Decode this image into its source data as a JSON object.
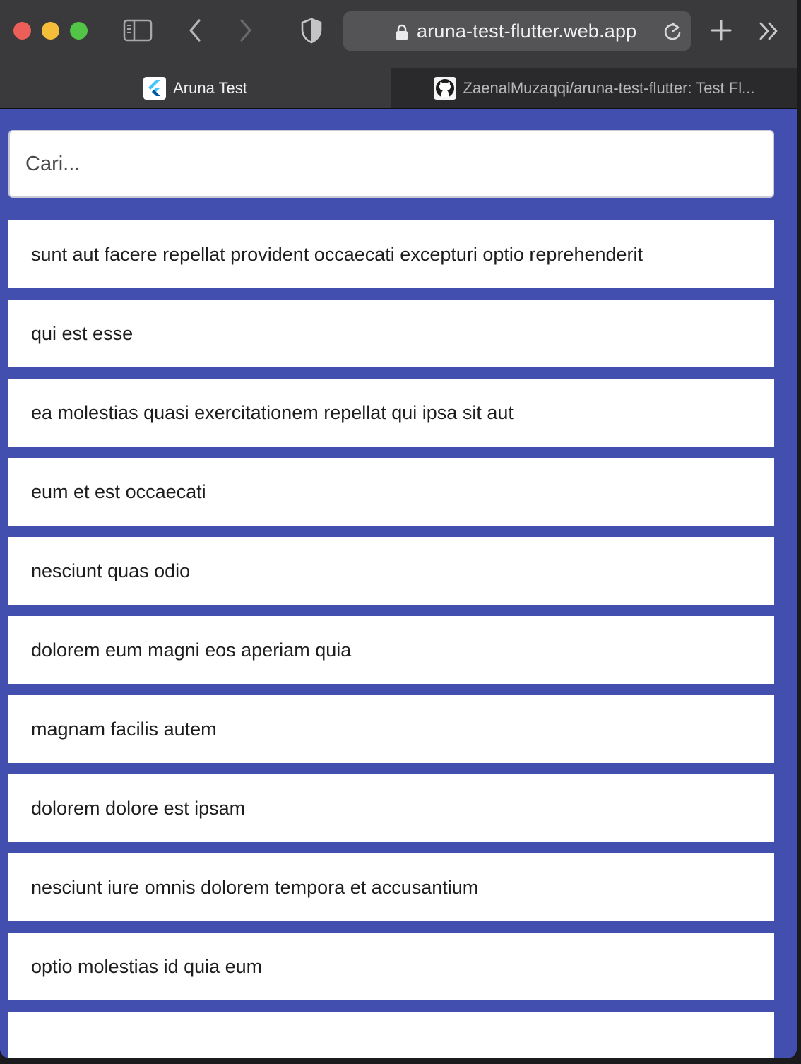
{
  "browser": {
    "url": "aruna-test-flutter.web.app",
    "tabs": [
      {
        "label": "Aruna Test",
        "favicon": "flutter-icon"
      },
      {
        "label": "ZaenalMuzaqqi/aruna-test-flutter: Test Fl...",
        "favicon": "github-icon"
      }
    ]
  },
  "search": {
    "placeholder": "Cari..."
  },
  "posts": [
    "sunt aut facere repellat provident occaecati excepturi optio reprehenderit",
    "qui est esse",
    "ea molestias quasi exercitationem repellat qui ipsa sit aut",
    "eum et est occaecati",
    "nesciunt quas odio",
    "dolorem eum magni eos aperiam quia",
    "magnam facilis autem",
    "dolorem dolore est ipsam",
    "nesciunt iure omnis dolorem tempora et accusantium",
    "optio molestias id quia eum",
    ""
  ],
  "colors": {
    "background": "#434faf",
    "card": "#ffffff",
    "toolbar": "#3a3a3c",
    "text": "#1d1d1d"
  }
}
